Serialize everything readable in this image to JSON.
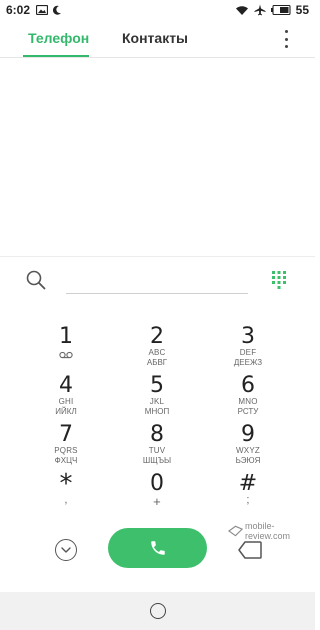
{
  "status_bar": {
    "time": "6:02",
    "battery": "55",
    "icons": [
      "image-icon",
      "moon-icon",
      "wifi-icon",
      "airplane-icon",
      "battery-icon"
    ]
  },
  "tabs": [
    {
      "label": "Телефон",
      "active": true
    },
    {
      "label": "Контакты",
      "active": false
    }
  ],
  "accent_color": "#34b86b",
  "call_color": "#3dbf6b",
  "dial": {
    "number": "",
    "keys": [
      {
        "digit": "1",
        "latin": "",
        "cyrillic": ""
      },
      {
        "digit": "2",
        "latin": "ABC",
        "cyrillic": "АБВГ"
      },
      {
        "digit": "3",
        "latin": "DEF",
        "cyrillic": "ДЕЕЖЗ"
      },
      {
        "digit": "4",
        "latin": "GHI",
        "cyrillic": "ИЙКЛ"
      },
      {
        "digit": "5",
        "latin": "JKL",
        "cyrillic": "МНОП"
      },
      {
        "digit": "6",
        "latin": "MNO",
        "cyrillic": "РСТУ"
      },
      {
        "digit": "7",
        "latin": "PQRS",
        "cyrillic": "ФХЦЧ"
      },
      {
        "digit": "8",
        "latin": "TUV",
        "cyrillic": "ШЩЪЫ"
      },
      {
        "digit": "9",
        "latin": "WXYZ",
        "cyrillic": "ЬЭЮЯ"
      },
      {
        "digit": "*",
        "latin": ",",
        "cyrillic": ""
      },
      {
        "digit": "0",
        "latin": "+",
        "cyrillic": ""
      },
      {
        "digit": "#",
        "latin": ";",
        "cyrillic": ""
      }
    ]
  },
  "watermark": "mobile-review.com"
}
